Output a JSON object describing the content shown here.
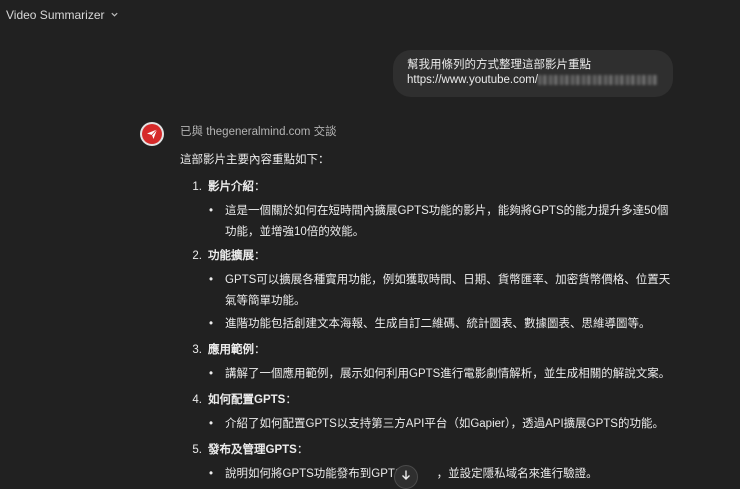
{
  "header": {
    "title": "Video Summarizer",
    "chevron_icon": "chevron-down-icon"
  },
  "user_message": {
    "line1": "幫我用條列的方式整理這部影片重點",
    "url_prefix": "https://www.youtube.com/"
  },
  "assistant": {
    "avatar_icon": "paper-plane-icon",
    "gpt_line": "已與 thegeneralmind.com 交談",
    "intro": "這部影片主要內容重點如下：",
    "sections": [
      {
        "num": "1.",
        "title": "影片介紹",
        "colon": "：",
        "bullets": [
          "這是一個關於如何在短時間內擴展GPTS功能的影片，能夠將GPTS的能力提升多達50個功能，並增強10倍的效能。"
        ]
      },
      {
        "num": "2.",
        "title": "功能擴展",
        "colon": "：",
        "bullets": [
          "GPTS可以擴展各種實用功能，例如獲取時間、日期、貨幣匯率、加密貨幣價格、位置天氣等簡單功能。",
          "進階功能包括創建文本海報、生成自訂二維碼、統計圖表、數據圖表、思維導圖等。"
        ]
      },
      {
        "num": "3.",
        "title": "應用範例",
        "colon": "：",
        "bullets": [
          "講解了一個應用範例，展示如何利用GPTS進行電影劇情解析，並生成相關的解說文案。"
        ]
      },
      {
        "num": "4.",
        "title": "如何配置GPTS",
        "colon": "：",
        "bullets": [
          "介紹了如何配置GPTS以支持第三方API平台（如Gapier），透過API擴展GPTS的功能。"
        ]
      },
      {
        "num": "5.",
        "title": "發布及管理GPTS",
        "colon": "：",
        "bullets": [
          "說明如何將GPTS功能發布到GPTS",
          "，並設定隱私域名來進行驗證。"
        ]
      }
    ]
  },
  "scroll_button": {
    "icon": "arrow-down-icon"
  }
}
